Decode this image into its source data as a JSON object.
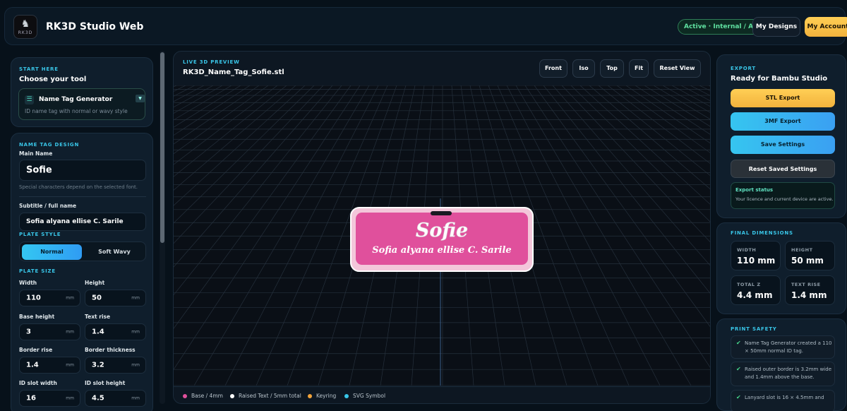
{
  "header": {
    "logo_text": "RK3D",
    "app_title": "RK3D Studio Web",
    "status_badge": "Active · Internal / Admin",
    "my_designs": "My Designs",
    "my_account": "My Account"
  },
  "tool_panel": {
    "section_label": "START HERE",
    "title": "Choose your tool",
    "selected_tool": "Name Tag Generator",
    "tool_description": "ID name tag with normal or wavy style"
  },
  "design_panel": {
    "section_label": "NAME TAG DESIGN",
    "main_name_label": "Main Name",
    "main_name_value": "Sofie",
    "main_name_hint": "Special characters depend on the selected font.",
    "subtitle_label": "Subtitle / full name",
    "subtitle_value": "Sofia alyana ellise C. Sarile",
    "plate_style_label": "PLATE STYLE",
    "style_options": [
      "Normal",
      "Soft Wavy"
    ],
    "selected_style": "Normal",
    "plate_size_label": "PLATE SIZE",
    "unit": "mm",
    "fields": [
      {
        "label": "Width",
        "value": "110"
      },
      {
        "label": "Height",
        "value": "50"
      },
      {
        "label": "Base height",
        "value": "3"
      },
      {
        "label": "Text rise",
        "value": "1.4"
      },
      {
        "label": "Border rise",
        "value": "1.4"
      },
      {
        "label": "Border thickness",
        "value": "3.2"
      },
      {
        "label": "ID slot width",
        "value": "16"
      },
      {
        "label": "ID slot height",
        "value": "4.5"
      }
    ]
  },
  "viewport": {
    "section_label": "LIVE 3D PREVIEW",
    "filename": "RK3D_Name_Tag_Sofie.stl",
    "view_buttons": [
      "Front",
      "Iso",
      "Top",
      "Fit",
      "Reset View"
    ],
    "tag_main_text": "Sofie",
    "tag_sub_text": "Sofia alyana ellise C. Sarile",
    "tag_color": "#e0509c",
    "legend": [
      {
        "label": "Base / 4mm",
        "color": "#e0509c"
      },
      {
        "label": "Raised Text / 5mm total",
        "color": "#ffffff"
      },
      {
        "label": "Keyring",
        "color": "#f2a33a"
      },
      {
        "label": "SVG Symbol",
        "color": "#38c6e8"
      }
    ]
  },
  "export_panel": {
    "section_label": "EXPORT",
    "title": "Ready for Bambu Studio",
    "stl_button": "STL Export",
    "threemf_button": "3MF Export",
    "save_button": "Save Settings",
    "reset_button": "Reset Saved Settings",
    "status_title": "Export status",
    "status_text": "Your licence and current device are active."
  },
  "dimensions_panel": {
    "section_label": "FINAL DIMENSIONS",
    "items": [
      {
        "label": "WIDTH",
        "value": "110 mm"
      },
      {
        "label": "HEIGHT",
        "value": "50 mm"
      },
      {
        "label": "TOTAL Z",
        "value": "4.4 mm"
      },
      {
        "label": "TEXT RISE",
        "value": "1.4 mm"
      }
    ]
  },
  "safety_panel": {
    "section_label": "PRINT SAFETY",
    "items": [
      "Name Tag Generator created a 110 × 50mm normal ID tag.",
      "Raised outer border is 3.2mm wide and 1.4mm above the base.",
      "Lanyard slot is 16 × 4.5mm and"
    ]
  }
}
